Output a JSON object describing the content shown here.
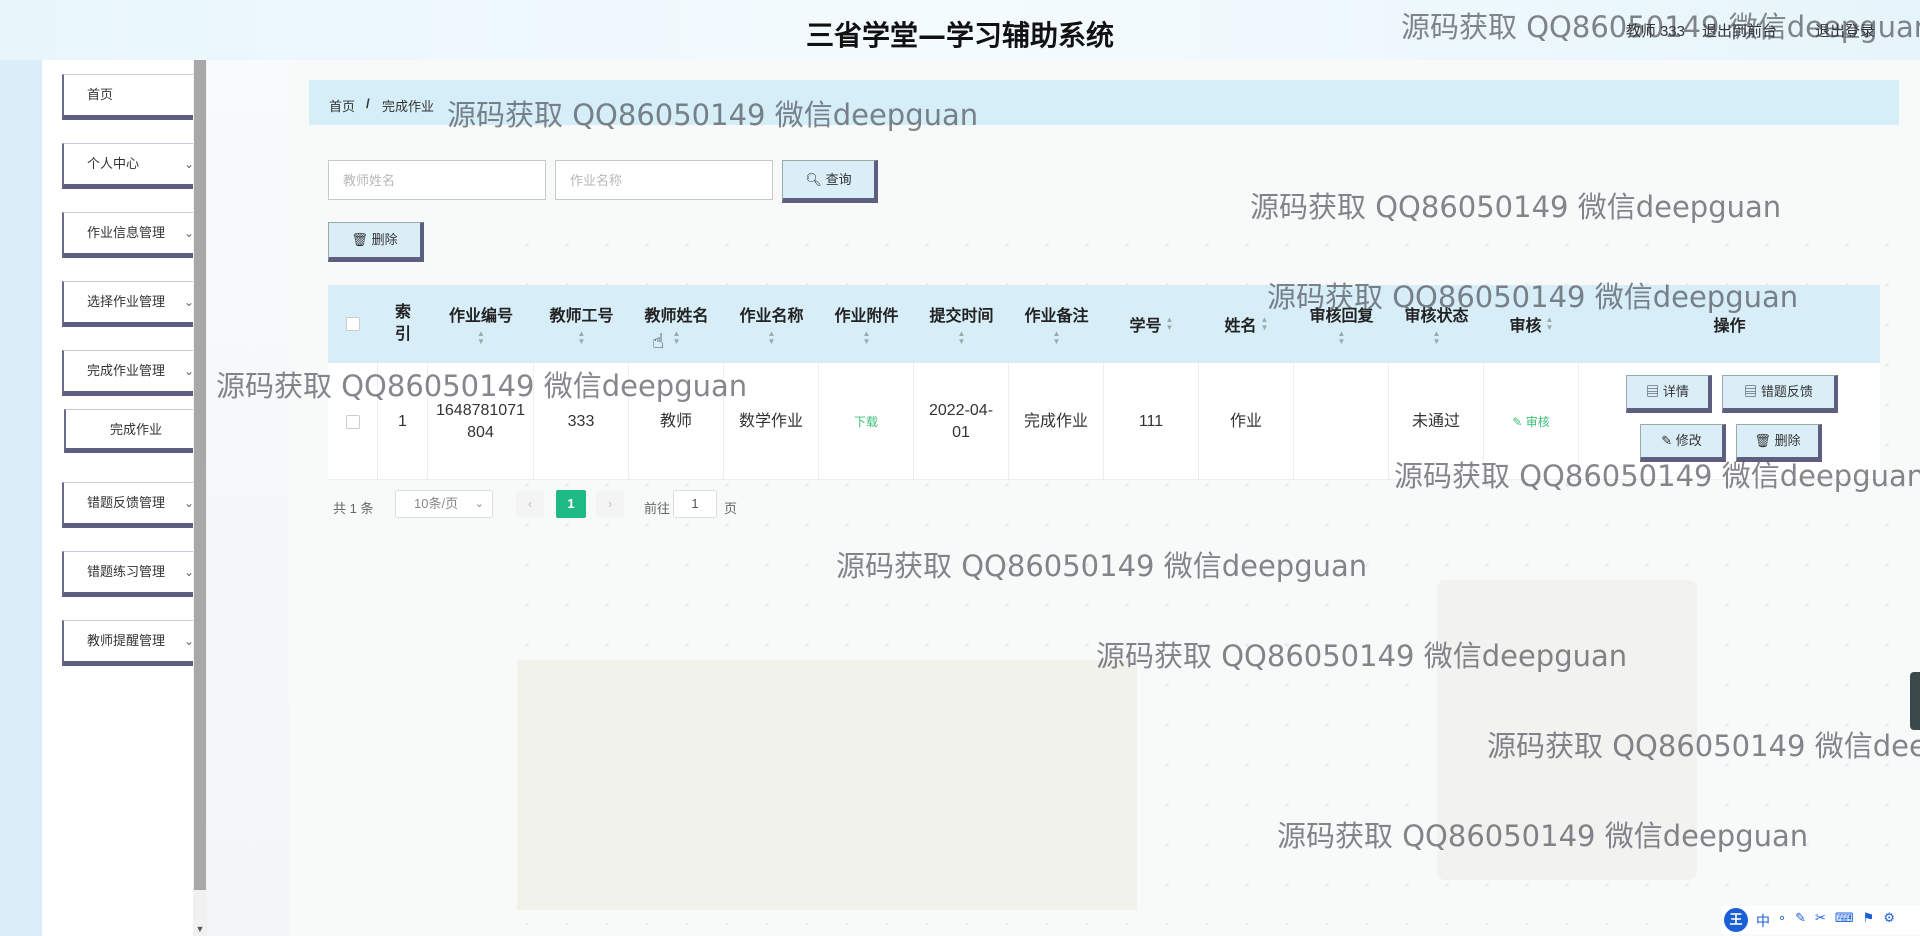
{
  "header": {
    "title": "三省学堂—学习辅助系统",
    "user": "教师 333",
    "front_link": "退出到前台",
    "logout_link": "退出登录"
  },
  "sidebar": {
    "items": [
      {
        "label": "首页",
        "has_arrow": false
      },
      {
        "label": "个人中心",
        "has_arrow": true
      },
      {
        "label": "作业信息管理",
        "has_arrow": true
      },
      {
        "label": "选择作业管理",
        "has_arrow": true
      },
      {
        "label": "完成作业管理",
        "has_arrow": true
      },
      {
        "label": "完成作业",
        "has_arrow": false,
        "sub": true
      },
      {
        "label": "错题反馈管理",
        "has_arrow": true
      },
      {
        "label": "错题练习管理",
        "has_arrow": true
      },
      {
        "label": "教师提醒管理",
        "has_arrow": true
      }
    ]
  },
  "breadcrumb": {
    "home": "首页",
    "separator": "/",
    "current": "完成作业"
  },
  "search": {
    "teacher_name_placeholder": "教师姓名",
    "homework_name_placeholder": "作业名称",
    "query_label": "查询"
  },
  "toolbar": {
    "delete_label": "删除"
  },
  "table": {
    "columns": [
      {
        "label": "索\n引",
        "sortable": false
      },
      {
        "label": "作业编号",
        "sortable": true
      },
      {
        "label": "教师工号",
        "sortable": true
      },
      {
        "label": "教师姓名",
        "sortable": true
      },
      {
        "label": "作业名称",
        "sortable": true
      },
      {
        "label": "作业附件",
        "sortable": true
      },
      {
        "label": "提交时间",
        "sortable": true
      },
      {
        "label": "作业备注",
        "sortable": true
      },
      {
        "label": "学号",
        "sortable": true
      },
      {
        "label": "姓名",
        "sortable": true
      },
      {
        "label": "审核回复",
        "sortable": true
      },
      {
        "label": "审核状态",
        "sortable": true
      },
      {
        "label": "审核",
        "sortable": true
      },
      {
        "label": "操作",
        "sortable": false
      }
    ],
    "rows": [
      {
        "index": "1",
        "homework_no": "1648781071804",
        "teacher_id": "333",
        "teacher_name": "教师",
        "homework_name": "数学作业",
        "attachment": "下载",
        "submit_time": "2022-04-01",
        "remark": "完成作业",
        "student_no": "111",
        "name": "作业",
        "review_reply": "",
        "review_status": "未通过",
        "review_action": "审核",
        "actions": {
          "detail": "详情",
          "feedback": "错题反馈",
          "edit": "修改",
          "delete": "删除"
        }
      }
    ]
  },
  "pager": {
    "total": "共 1 条",
    "page_size": "10条/页",
    "current_page": "1",
    "goto_prefix": "前往",
    "goto_value": "1",
    "goto_suffix": "页"
  },
  "watermark": "源码获取 QQ86050149 微信deepguan",
  "ime": {
    "logo": "王",
    "lang": "中"
  }
}
